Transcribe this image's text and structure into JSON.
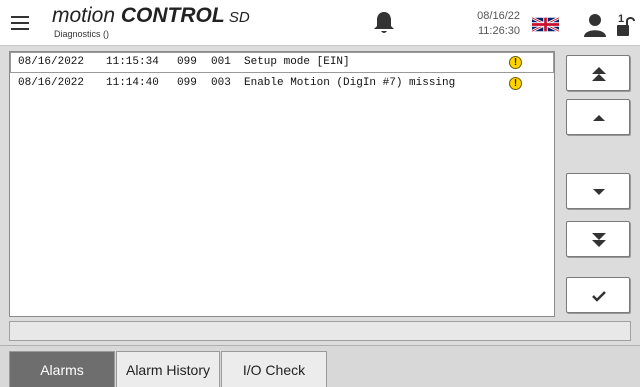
{
  "header": {
    "brand_light": "motion ",
    "brand_bold": "CONTROL",
    "brand_suffix": " SD",
    "subtitle": "Diagnostics ()",
    "date": "08/16/22",
    "time": "11:26:30",
    "icons": {
      "menu": "hamburger-menu-icon",
      "alarm": "bell-icon",
      "language": "uk-flag-icon",
      "user": "user-icon",
      "access_level": "lock-level-1-icon"
    },
    "access_level": "1"
  },
  "alarms": [
    {
      "date": "08/16/2022",
      "time": "11:15:34",
      "code1": "099",
      "code2": "001",
      "text": "Setup mode [EIN]",
      "severity": "warning"
    },
    {
      "date": "08/16/2022",
      "time": "11:14:40",
      "code1": "099",
      "code2": "003",
      "text": "Enable Motion (DigIn #7) missing",
      "severity": "warning"
    }
  ],
  "scroll_buttons": {
    "top": "double-chevron-up-icon",
    "up": "triangle-up-icon",
    "down": "triangle-down-icon",
    "bottom": "double-chevron-down-icon",
    "acknowledge": "checkmark-icon"
  },
  "status_text": "",
  "tabs": [
    {
      "label": "Alarms",
      "active": true
    },
    {
      "label": "Alarm History",
      "active": false
    },
    {
      "label": "I/O Check",
      "active": false
    }
  ],
  "colors": {
    "warning": "#ffd400",
    "active_tab": "#6e6e6e",
    "flag_blue": "#012169",
    "flag_red": "#c8102e"
  }
}
